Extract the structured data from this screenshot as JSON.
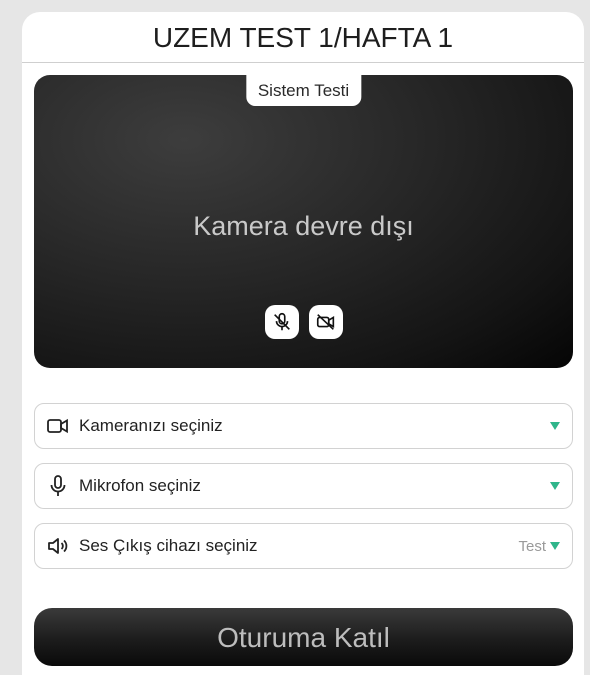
{
  "title": "UZEM TEST 1/HAFTA 1",
  "preview": {
    "tab_label": "Sistem Testi",
    "status_text": "Kamera devre dışı"
  },
  "selects": {
    "camera": {
      "label": "Kameranızı seçiniz",
      "icon": "video-camera-icon"
    },
    "microphone": {
      "label": "Mikrofon seçiniz",
      "icon": "microphone-icon"
    },
    "speaker": {
      "label": "Ses Çıkış cihazı seçiniz",
      "icon": "speaker-icon",
      "test_label": "Test"
    }
  },
  "join_button": "Oturuma Katıl",
  "colors": {
    "caret": "#2fb58a",
    "preview_bg": "#1a1a1a",
    "join_bg": "#1c1c1c"
  }
}
